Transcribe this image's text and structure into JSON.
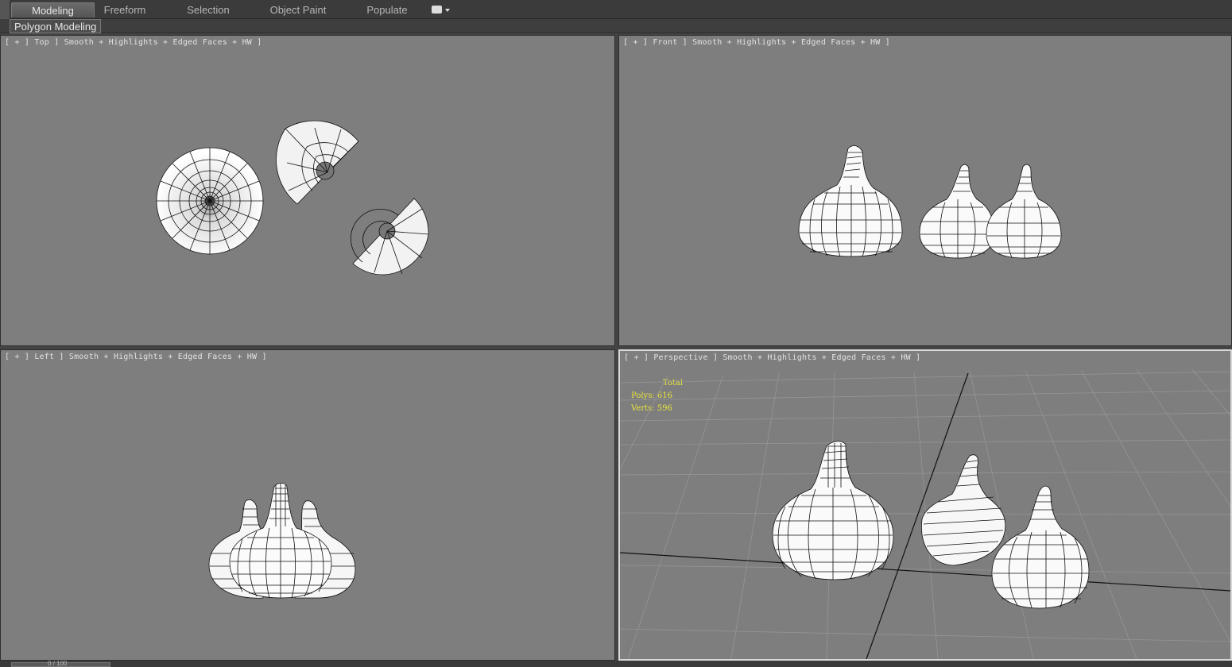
{
  "ribbon": {
    "tabs": [
      "Modeling",
      "Freeform",
      "Selection",
      "Object Paint",
      "Populate"
    ],
    "active_tab": "Modeling",
    "panel_label": "Polygon Modeling"
  },
  "viewports": {
    "top": "[ + ] Top ] Smooth + Highlights + Edged Faces + HW ]",
    "front": "[ + ] Front ] Smooth + Highlights + Edged Faces + HW ]",
    "left": "[ + ] Left ] Smooth + Highlights + Edged Faces + HW ]",
    "perspective": "[ + ] Perspective ] Smooth + Highlights + Edged Faces + HW ]"
  },
  "stats": {
    "total": "Total",
    "polys": "Polys: 616",
    "verts": "Verts: 596"
  },
  "timeline": {
    "frame": "0 / 100"
  },
  "colors": {
    "viewport_bg": "#7e7e7e",
    "ui_bg": "#444444",
    "stats_text": "#e8e43c",
    "mesh_fill": "#ffffff",
    "wire": "#000000"
  }
}
